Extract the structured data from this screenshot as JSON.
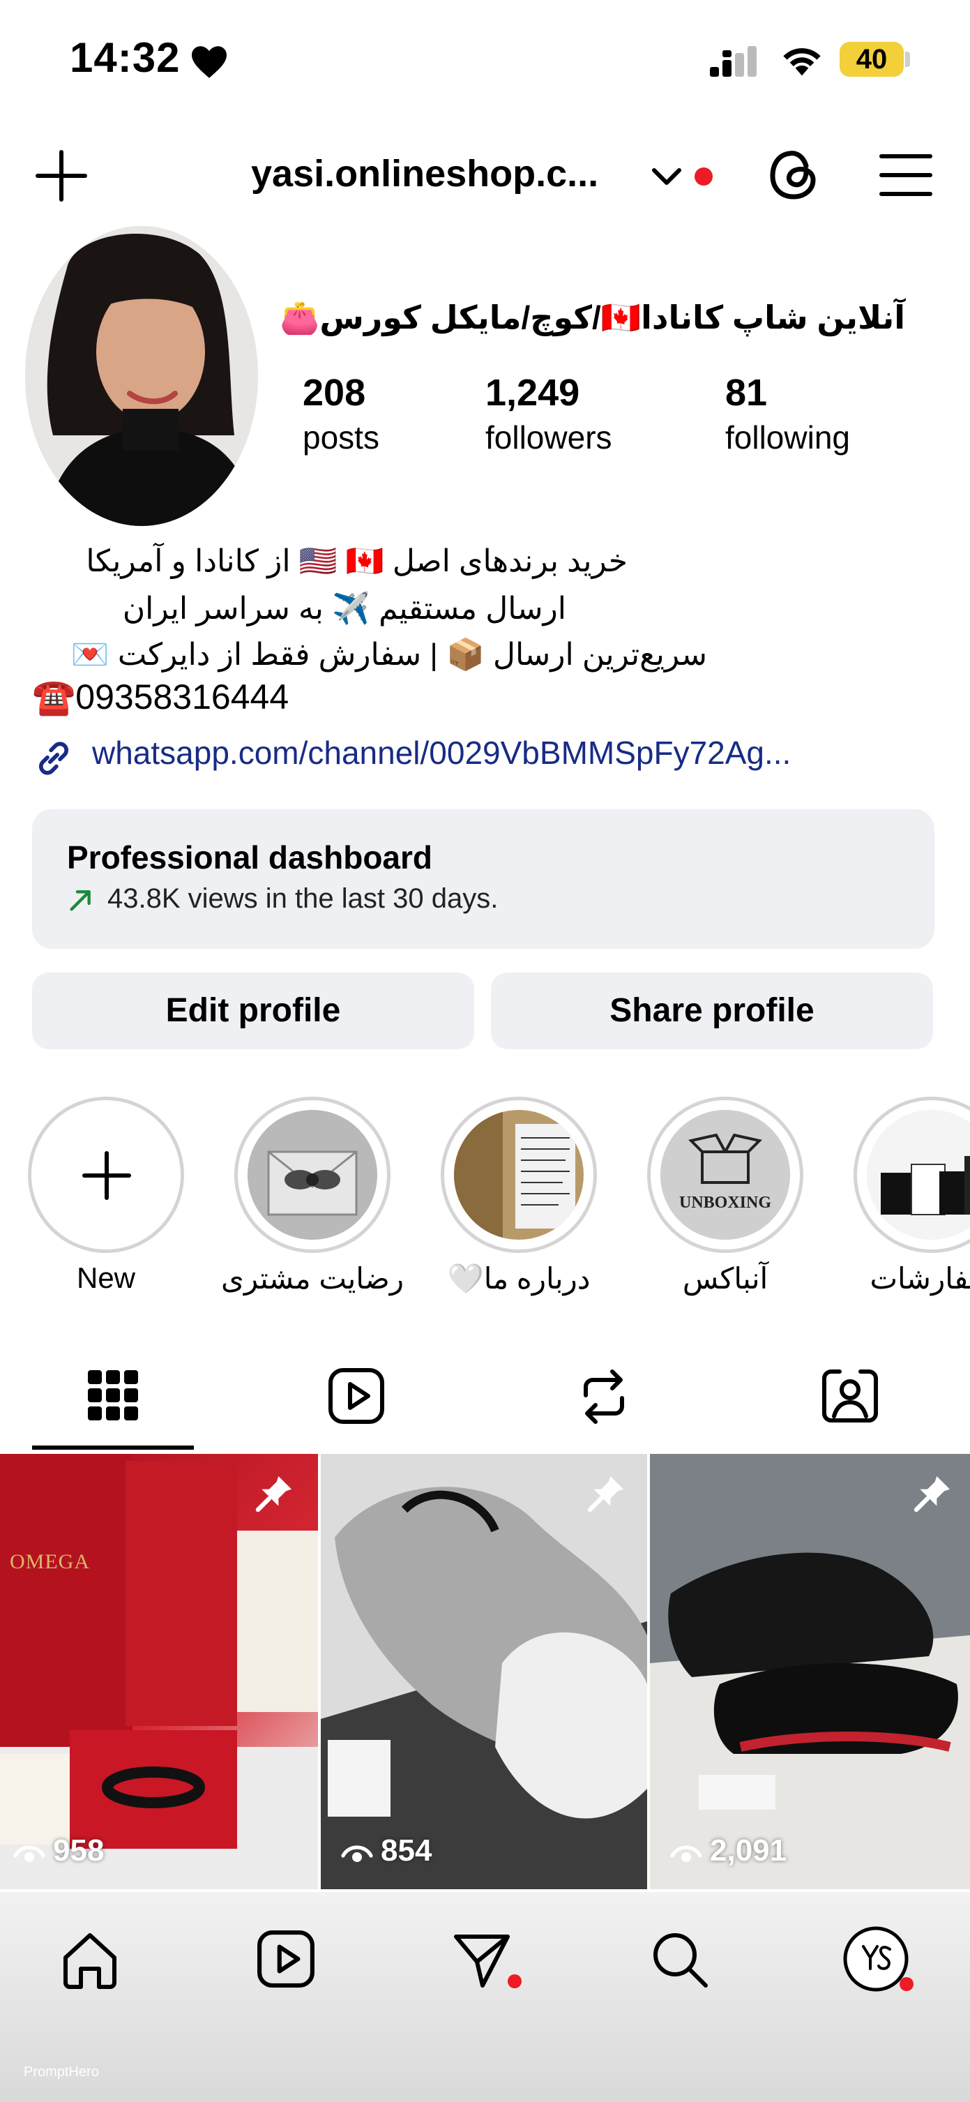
{
  "status_bar": {
    "time": "14:32",
    "battery": "40"
  },
  "header": {
    "username": "yasi.onlineshop.c...",
    "display_name": "آنلاین شاپ کانادا🇨🇦/کوچ/مایکل کورس👛"
  },
  "stats": [
    {
      "count": "208",
      "label": "posts"
    },
    {
      "count": "1,249",
      "label": "followers"
    },
    {
      "count": "81",
      "label": "following"
    }
  ],
  "bio": {
    "line1": "خرید برندهای اصل 🇺🇸 🇨🇦 از کانادا و آمریکا",
    "line2": "ارسال مستقیم ✈️ به سراسر ایران",
    "line3": "سریع‌ترین ارسال 📦 | سفارش فقط از دایرکت 💌",
    "phone": "☎️09358316444",
    "link": "whatsapp.com/channel/0029VbBMMSpFy72Ag..."
  },
  "dashboard": {
    "title": "Professional dashboard",
    "subtitle": "43.8K views in the last 30 days."
  },
  "buttons": {
    "edit": "Edit profile",
    "share": "Share profile"
  },
  "highlights": [
    {
      "label": "New"
    },
    {
      "label": "رضایت مشتری"
    },
    {
      "label": "درباره ما🤍"
    },
    {
      "label": "آنباکس",
      "image_text": "UNBOXING"
    },
    {
      "label": "سفارشات"
    }
  ],
  "posts": [
    {
      "views": "958",
      "brand_text": "OMEGA"
    },
    {
      "views": "854"
    },
    {
      "views": "2,091"
    }
  ],
  "colors": {
    "accent_red": "#ed1c24",
    "link_blue": "#182b86",
    "battery_yellow": "#f3cf3a"
  }
}
